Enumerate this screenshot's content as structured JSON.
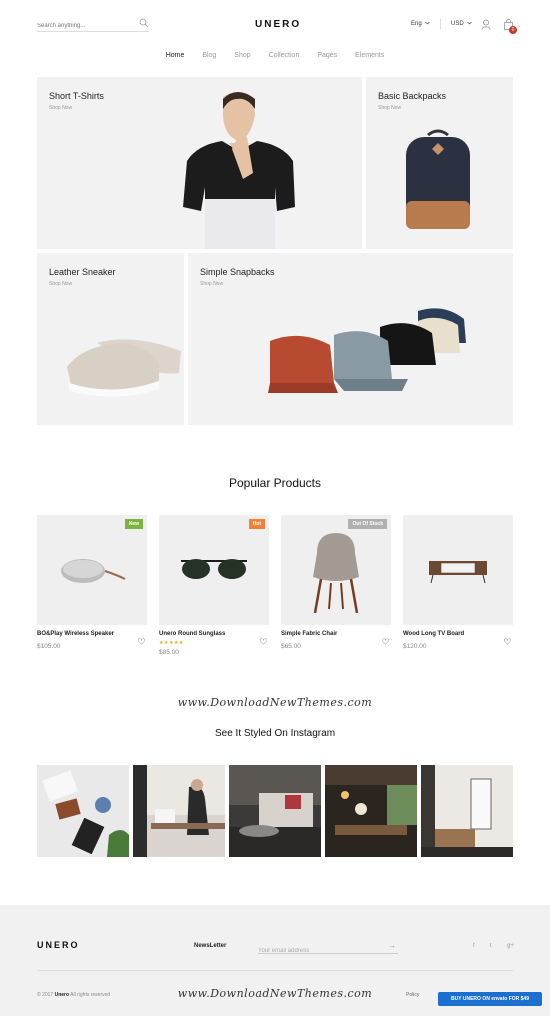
{
  "header": {
    "search_placeholder": "Search anything...",
    "logo": "UNERO",
    "language": "Eng",
    "currency": "USD",
    "cart_count": "0"
  },
  "nav": [
    "Home",
    "Blog",
    "Shop",
    "Collection",
    "Pages",
    "Elements"
  ],
  "banners": [
    {
      "title": "Short T-Shirts",
      "cta": "Shop Now"
    },
    {
      "title": "Basic Backpacks",
      "cta": "Shop Now"
    },
    {
      "title": "Leather Sneaker",
      "cta": "Shop Now"
    },
    {
      "title": "Simple Snapbacks",
      "cta": "Shop Now"
    }
  ],
  "popular": {
    "title": "Popular Products",
    "items": [
      {
        "name": "BO&Play Wireless Speaker",
        "price": "$105.00",
        "tag": "New",
        "tag_color": "#7cb342"
      },
      {
        "name": "Unero Round Sunglass",
        "price": "$85.00",
        "tag": "Hot",
        "tag_color": "#f0813c",
        "rating": "★★★★★"
      },
      {
        "name": "Simple Fabric Chair",
        "price": "$65.00",
        "tag": "Out Of Stock",
        "tag_color": "#b0b0b0"
      },
      {
        "name": "Wood Long TV Board",
        "price": "$120.00"
      }
    ]
  },
  "watermark": "www.DownloadNewThemes.com",
  "instagram": {
    "title": "See It Styled On Instagram"
  },
  "footer": {
    "logo": "UNERO",
    "newsletter_label": "NewsLetter",
    "email_placeholder": "Your email address",
    "social": [
      "f",
      "t",
      "g+"
    ],
    "copyright_prefix": "© 2017",
    "copyright_brand": "Unero",
    "copyright_suffix": "All rights reserved",
    "policy": "Policy",
    "buy_button": "BUY UNERO ON envato FOR $49"
  }
}
